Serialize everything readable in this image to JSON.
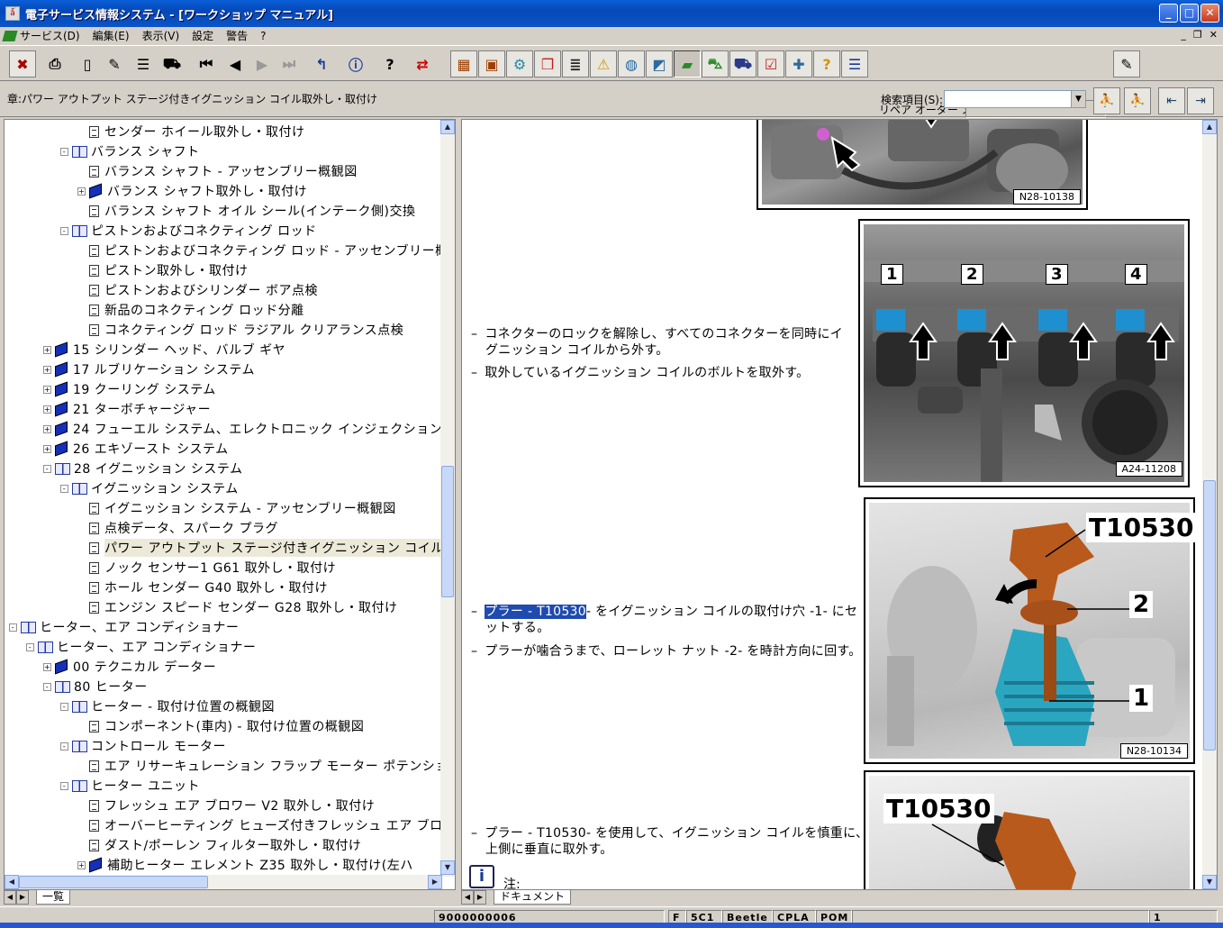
{
  "window": {
    "title": "電子サービス情報システム - [ワークショップ マニュアル]"
  },
  "menu": {
    "items": [
      "サービス(D)",
      "編集(E)",
      "表示(V)",
      "設定",
      "警告",
      "?"
    ]
  },
  "toolbar": {
    "memo_label": "リペア オーダー メモ:",
    "memo_value": ""
  },
  "breadcrumb": {
    "chapter": "章:パワー アウトプット ステージ付きイグニッション コイル取外し・取付け"
  },
  "search": {
    "label": "検索項目(S):",
    "value": ""
  },
  "tree": {
    "items": [
      {
        "label": "センダー ホイール取外し・取付け",
        "type": "doc",
        "level": 5
      },
      {
        "label": "バランス シャフト",
        "type": "open",
        "level": 4,
        "exp": "-"
      },
      {
        "label": "バランス シャフト - アッセンブリー概観図",
        "type": "doc",
        "level": 5
      },
      {
        "label": "バランス シャフト取外し・取付け",
        "type": "book",
        "level": 5,
        "exp": "+"
      },
      {
        "label": "バランス シャフト オイル シール(インテーク側)交換",
        "type": "doc",
        "level": 5
      },
      {
        "label": "ピストンおよびコネクティング ロッド",
        "type": "open",
        "level": 4,
        "exp": "-"
      },
      {
        "label": "ピストンおよびコネクティング ロッド - アッセンブリー概観",
        "type": "doc",
        "level": 5
      },
      {
        "label": "ピストン取外し・取付け",
        "type": "doc",
        "level": 5
      },
      {
        "label": "ピストンおよびシリンダー ボア点検",
        "type": "doc",
        "level": 5
      },
      {
        "label": "新品のコネクティング ロッド分離",
        "type": "doc",
        "level": 5
      },
      {
        "label": "コネクティング ロッド ラジアル クリアランス点検",
        "type": "doc",
        "level": 5
      },
      {
        "label": "15 シリンダー ヘッド、バルブ ギヤ",
        "type": "book",
        "level": 3,
        "exp": "+"
      },
      {
        "label": "17 ルブリケーション システム",
        "type": "book",
        "level": 3,
        "exp": "+"
      },
      {
        "label": "19 クーリング システム",
        "type": "book",
        "level": 3,
        "exp": "+"
      },
      {
        "label": "21 ターボチャージャー",
        "type": "book",
        "level": 3,
        "exp": "+"
      },
      {
        "label": "24 フューエル システム、エレクトロニック インジェクション",
        "type": "book",
        "level": 3,
        "exp": "+"
      },
      {
        "label": "26 エキゾースト システム",
        "type": "book",
        "level": 3,
        "exp": "+"
      },
      {
        "label": "28 イグニッション システム",
        "type": "open",
        "level": 3,
        "exp": "-"
      },
      {
        "label": "イグニッション システム",
        "type": "open",
        "level": 4,
        "exp": "-"
      },
      {
        "label": "イグニッション システム - アッセンブリー概観図",
        "type": "doc",
        "level": 5
      },
      {
        "label": "点検データ、スパーク プラグ",
        "type": "doc",
        "level": 5
      },
      {
        "label": "パワー アウトプット ステージ付きイグニッション コイル取外",
        "type": "doc",
        "level": 5,
        "selected": true
      },
      {
        "label": "ノック センサー1 G61 取外し・取付け",
        "type": "doc",
        "level": 5
      },
      {
        "label": "ホール センダー G40 取外し・取付け",
        "type": "doc",
        "level": 5
      },
      {
        "label": "エンジン スピード センダー G28 取外し・取付け",
        "type": "doc",
        "level": 5
      },
      {
        "label": "ヒーター、エア コンディショナー",
        "type": "open",
        "level": 1,
        "exp": "-"
      },
      {
        "label": "ヒーター、エア コンディショナー",
        "type": "open",
        "level": 2,
        "exp": "-"
      },
      {
        "label": "00 テクニカル データー",
        "type": "book",
        "level": 3,
        "exp": "+"
      },
      {
        "label": "80 ヒーター",
        "type": "open",
        "level": 3,
        "exp": "-"
      },
      {
        "label": "ヒーター - 取付け位置の概観図",
        "type": "open",
        "level": 4,
        "exp": "-"
      },
      {
        "label": "コンポーネント(車内) - 取付け位置の概観図",
        "type": "doc",
        "level": 5
      },
      {
        "label": "コントロール モーター",
        "type": "open",
        "level": 4,
        "exp": "-"
      },
      {
        "label": "エア リサーキュレーション フラップ モーター ポテンショメ",
        "type": "doc",
        "level": 5
      },
      {
        "label": "ヒーター ユニット",
        "type": "open",
        "level": 4,
        "exp": "-"
      },
      {
        "label": "フレッシュ エア ブロワー V2 取外し・取付け",
        "type": "doc",
        "level": 5
      },
      {
        "label": "オーバーヒーティング ヒューズ付きフレッシュ エア ブロワ",
        "type": "doc",
        "level": 5
      },
      {
        "label": "ダスト/ポーレン フィルター取外し・取付け",
        "type": "doc",
        "level": 5
      },
      {
        "label": "補助ヒーター エレメント Z35 取外し・取付け(左ハ",
        "type": "book",
        "level": 5,
        "exp": "+"
      }
    ]
  },
  "tabs": {
    "left": "一覧",
    "right": "ドキュメント"
  },
  "doc": {
    "step1a": "コネクターのロックを解除し、すべてのコネクターを同時にイ",
    "step1b": "グニッション コイルから外す。",
    "step2": "取外しているイグニッション コイルのボルトを取外す。",
    "step3_hl": "プラー - T10530",
    "step3a": "- をイグニッション コイルの取付け穴 -1- にセ",
    "step3b": "ットする。",
    "step4": "プラーが噛合うまで、ローレット ナット -2- を時計方向に回す。",
    "step5a": "プラー - T10530- を使用して、イグニッション コイルを慎重に、",
    "step5b": "上側に垂直に取外す。",
    "note": "注:",
    "fig1": "N28-10138",
    "fig2": "A24-11208",
    "fig3": "N28-10134",
    "callouts": [
      "1",
      "2",
      "3",
      "4"
    ],
    "tool": "T10530",
    "part2": "2",
    "part1": "1"
  },
  "status": {
    "order": "9000000006",
    "f": "F",
    "code": "5C1",
    "model": "Beetle",
    "engine": "CPLA",
    "gear": "POM",
    "page": "1"
  }
}
